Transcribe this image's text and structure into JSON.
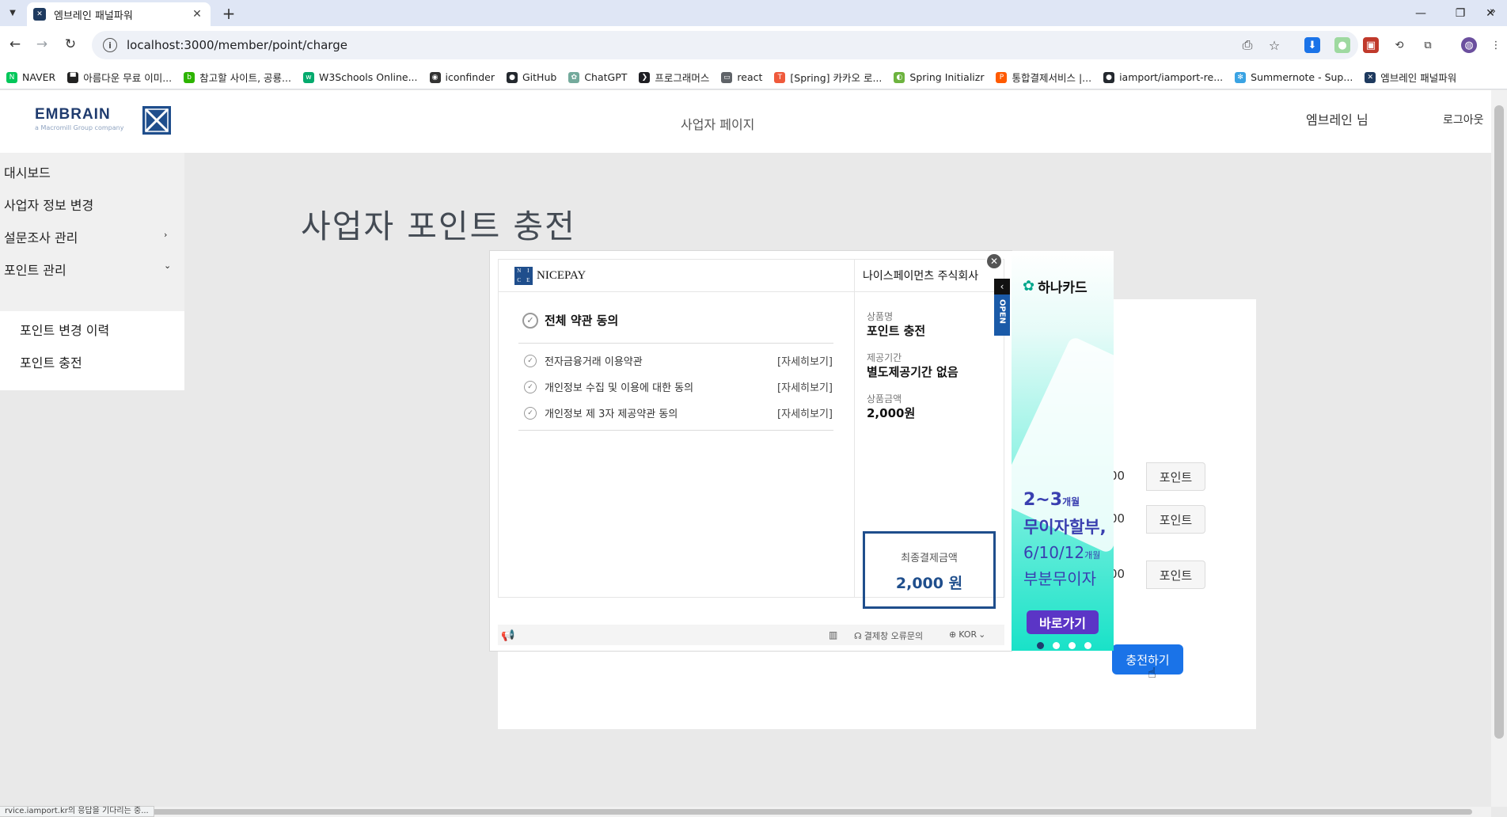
{
  "browser": {
    "tab_title": "엠브레인 패널파워",
    "url": "localhost:3000/member/point/charge",
    "bookmarks": [
      {
        "label": "NAVER",
        "color": "#03c75a",
        "glyph": "N"
      },
      {
        "label": "아름다운 무료 이미...",
        "color": "#222222",
        "glyph": "▀"
      },
      {
        "label": "참고할 사이트, 공룡...",
        "color": "#2db400",
        "glyph": "b"
      },
      {
        "label": "W3Schools Online...",
        "color": "#04aa6d",
        "glyph": "w"
      },
      {
        "label": "iconfinder",
        "color": "#333333",
        "glyph": "◉"
      },
      {
        "label": "GitHub",
        "color": "#24292f",
        "glyph": "●"
      },
      {
        "label": "ChatGPT",
        "color": "#74aa9c",
        "glyph": "✿"
      },
      {
        "label": "프로그래머스",
        "color": "#1e1e23",
        "glyph": "❯"
      },
      {
        "label": "react",
        "color": "#5f6368",
        "glyph": "▭"
      },
      {
        "label": "[Spring] 카카오 로...",
        "color": "#ef5a3c",
        "glyph": "T"
      },
      {
        "label": "Spring Initializr",
        "color": "#6db33f",
        "glyph": "◐"
      },
      {
        "label": "통합결제서비스 |...",
        "color": "#ff5a00",
        "glyph": "P"
      },
      {
        "label": "iamport/iamport-re...",
        "color": "#24292f",
        "glyph": "●"
      },
      {
        "label": "Summernote - Sup...",
        "color": "#3aa3e3",
        "glyph": "✻"
      },
      {
        "label": "엠브레인 패널파워",
        "color": "#1e3a5f",
        "glyph": "✕"
      }
    ],
    "status_text": "rvice.iamport.kr의 응답을 기다리는 중..."
  },
  "header": {
    "logo_word": "EMBRAIN",
    "logo_sub": "a Macromill Group company",
    "title": "사업자 페이지",
    "user": "엠브레인 님",
    "logout": "로그아웃"
  },
  "sidebar": {
    "items": [
      "대시보드",
      "사업자 정보 변경",
      "설문조사 관리",
      "포인트 관리"
    ],
    "arrows": [
      "›",
      "⌄"
    ],
    "sub_items": [
      "포인트 변경 이력",
      "포인트 충전"
    ]
  },
  "main": {
    "heading": "사업자 포인트 충전",
    "point_rows": [
      {
        "amount": "00",
        "unit": "포인트"
      },
      {
        "amount": "00",
        "unit": "포인트"
      },
      {
        "amount": "00",
        "unit": "포인트"
      }
    ],
    "charge_button": "충전하기"
  },
  "popup": {
    "brand": "NICEPAY",
    "brand_box": [
      "N",
      "I",
      "C",
      "E"
    ],
    "agree_all": "전체 약관 동의",
    "terms": [
      {
        "label": "전자금융거래 이용약관",
        "more": "[자세히보기]"
      },
      {
        "label": "개인정보 수집 및 이용에 대한 동의",
        "more": "[자세히보기]"
      },
      {
        "label": "개인정보 제 3자 제공약관 동의",
        "more": "[자세히보기]"
      }
    ],
    "company": "나이스페이먼츠 주식회사",
    "product_label": "상품명",
    "product_value": "포인트 충전",
    "period_label": "제공기간",
    "period_value": "별도제공기간 없음",
    "price_label": "상품금액",
    "price_value": "2,000원",
    "final_label": "최종결제금액",
    "final_value": "2,000 원",
    "footer_error": "결제창 오류문의",
    "footer_lang": "KOR",
    "open_label": "OPEN"
  },
  "banner": {
    "brand": "하나카드",
    "line1": "2~3",
    "line1_unit": "개월",
    "line2": "무이자할부,",
    "line3": "6/10/12",
    "line3_unit": "개월",
    "line4": "부분무이자",
    "button": "바로가기"
  }
}
